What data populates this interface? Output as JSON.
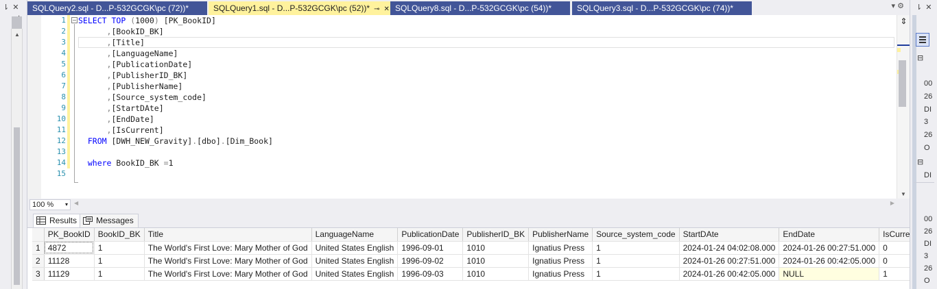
{
  "left_strip": {
    "pin_glyph": "⇂ ✕",
    "overflow_glyph": "⁚"
  },
  "tabs": [
    {
      "label": "SQLQuery2.sql - D...P-532GCGK\\pc (72))*",
      "active": false
    },
    {
      "label": "SQLQuery1.sql - D...P-532GCGK\\pc (52))*",
      "active": true,
      "pin": "⊸",
      "close": "✕"
    },
    {
      "label": "SQLQuery8.sql - D...P-532GCGK\\pc (54))*",
      "active": false
    },
    {
      "label": "SQLQuery3.sql - D...P-532GCGK\\pc (74))*",
      "active": false
    }
  ],
  "tab_tools": "▾   ⚙",
  "editor": {
    "line_numbers": [
      "1",
      "2",
      "3",
      "4",
      "5",
      "6",
      "7",
      "8",
      "9",
      "10",
      "11",
      "12",
      "13",
      "14",
      "15"
    ],
    "changed_lines": [
      1,
      2,
      3,
      4,
      5,
      6,
      7,
      8,
      9,
      10,
      11,
      12,
      13,
      14
    ],
    "code": {
      "l1_kw1": "SELECT",
      "l1_kw2": "TOP",
      "l1_p1": "(",
      "l1_num": "1000",
      "l1_p2": ")",
      "l1_id": "[PK_BookID]",
      "l2_id": "[BookID_BK]",
      "l3_id": "[Title]",
      "l4_id": "[LanguageName]",
      "l5_id": "[PublicationDate]",
      "l6_id": "[PublisherID_BK]",
      "l7_id": "[PublisherName]",
      "l8_id": "[Source_system_code]",
      "l9_id": "[StartDAte]",
      "l10_id": "[EndDate]",
      "l11_id": "[IsCurrent]",
      "l12_kw": "FROM",
      "l12_db": "[DWH_NEW_Gravity]",
      "l12_dot1": ".",
      "l12_schema": "[dbo]",
      "l12_dot2": ".",
      "l12_table": "[Dim_Book]",
      "l14_kw": "where",
      "l14_col": "BookID_BK",
      "l14_op": "=",
      "l14_val": "1",
      "comma": ","
    },
    "collapse_glyph": "−"
  },
  "zoom": {
    "value": "100 %",
    "arrow": "▾"
  },
  "results_tabs": [
    {
      "label": "Results",
      "active": true
    },
    {
      "label": "Messages",
      "active": false
    }
  ],
  "grid": {
    "columns": [
      "PK_BookID",
      "BookID_BK",
      "Title",
      "LanguageName",
      "PublicationDate",
      "PublisherID_BK",
      "PublisherName",
      "Source_system_code",
      "StartDAte",
      "EndDate",
      "IsCurrent"
    ],
    "rows": [
      {
        "rn": "1",
        "cells": [
          "4872",
          "1",
          "The World's First Love: Mary  Mother of God",
          "United States English",
          "1996-09-01",
          "1010",
          "Ignatius Press",
          "1",
          "2024-01-24 04:02:08.000",
          "2024-01-26 00:27:51.000",
          "0"
        ]
      },
      {
        "rn": "2",
        "cells": [
          "11128",
          "1",
          "The World's First Love: Mary  Mother of God",
          "United States English",
          "1996-09-02",
          "1010",
          "Ignatius Press",
          "1",
          "2024-01-26 00:27:51.000",
          "2024-01-26 00:42:05.000",
          "0"
        ]
      },
      {
        "rn": "3",
        "cells": [
          "11129",
          "1",
          "The World's First Love: Mary  Mother of God",
          "United States English",
          "1996-09-03",
          "1010",
          "Ignatius Press",
          "1",
          "2024-01-26 00:42:05.000",
          "NULL",
          "1"
        ]
      }
    ]
  },
  "right_panel": {
    "pin_glyph": "⇂ ✕",
    "collapse_glyph": "⊟",
    "clipped_values": [
      "00",
      "26",
      "DI",
      "3",
      "26",
      "O"
    ],
    "clipped_label": "DI"
  },
  "colors": {
    "tab_inactive": "#425598",
    "tab_active": "#fff29d",
    "keyword": "#0000ff",
    "line_number": "#2b91af",
    "function": "#ff00ff"
  }
}
